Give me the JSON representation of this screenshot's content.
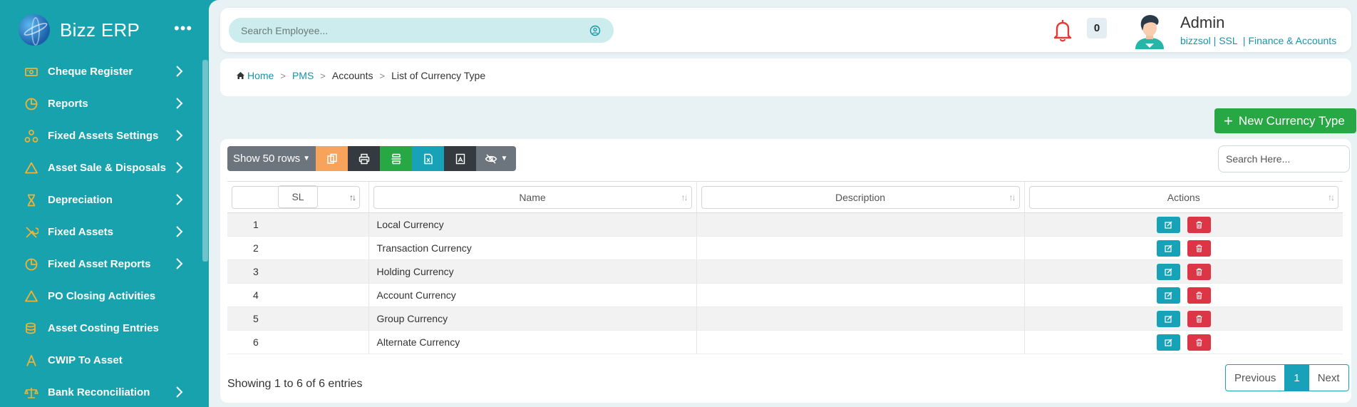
{
  "brand": {
    "name": "Bizz ERP"
  },
  "sidebar": {
    "menu_icon": "more-dots-icon",
    "items": [
      {
        "label": "Cheque Register",
        "icon": "money-bill-icon",
        "has_chevron": true
      },
      {
        "label": "Reports",
        "icon": "pie-chart-icon",
        "has_chevron": true
      },
      {
        "label": "Fixed Assets Settings",
        "icon": "nodes-icon",
        "has_chevron": true
      },
      {
        "label": "Asset Sale & Disposals",
        "icon": "triangle-warning-icon",
        "has_chevron": true
      },
      {
        "label": "Depreciation",
        "icon": "hourglass-icon",
        "has_chevron": true
      },
      {
        "label": "Fixed Assets",
        "icon": "tools-icon",
        "has_chevron": true
      },
      {
        "label": "Fixed Asset Reports",
        "icon": "pie-chart-icon",
        "has_chevron": true
      },
      {
        "label": "PO Closing Activities",
        "icon": "triangle-warning-icon",
        "has_chevron": false
      },
      {
        "label": "Asset Costing Entries",
        "icon": "coins-icon",
        "has_chevron": false
      },
      {
        "label": "CWIP To Asset",
        "icon": "compass-icon",
        "has_chevron": false
      },
      {
        "label": "Bank Reconciliation",
        "icon": "balance-scale-icon",
        "has_chevron": true
      }
    ]
  },
  "header": {
    "search_placeholder": "Search Employee...",
    "notification_count": "0",
    "user_name": "Admin",
    "user_info": "bizzsol | SSL  | Finance & Accounts"
  },
  "breadcrumb": {
    "home": "Home",
    "pms": "PMS",
    "accounts": "Accounts",
    "current": "List of Currency Type"
  },
  "actions": {
    "new_button": "New Currency Type"
  },
  "toolbar": {
    "rows_label": "Show 50 rows"
  },
  "table": {
    "search_placeholder": "Search Here...",
    "headers": {
      "sl": "SL",
      "name": "Name",
      "description": "Description",
      "actions": "Actions"
    },
    "rows": [
      {
        "sl": "1",
        "name": "Local Currency",
        "description": ""
      },
      {
        "sl": "2",
        "name": "Transaction Currency",
        "description": ""
      },
      {
        "sl": "3",
        "name": "Holding Currency",
        "description": ""
      },
      {
        "sl": "4",
        "name": "Account Currency",
        "description": ""
      },
      {
        "sl": "5",
        "name": "Group Currency",
        "description": ""
      },
      {
        "sl": "6",
        "name": "Alternate Currency",
        "description": ""
      }
    ]
  },
  "footer": {
    "info": "Showing 1 to 6 of 6 entries",
    "prev": "Previous",
    "page": "1",
    "next": "Next"
  },
  "colors": {
    "sidebar_bg": "#17a2ae",
    "icon_gold": "#f2b233",
    "primary": "#17a2b8",
    "success": "#28a745",
    "danger": "#dc3545"
  }
}
